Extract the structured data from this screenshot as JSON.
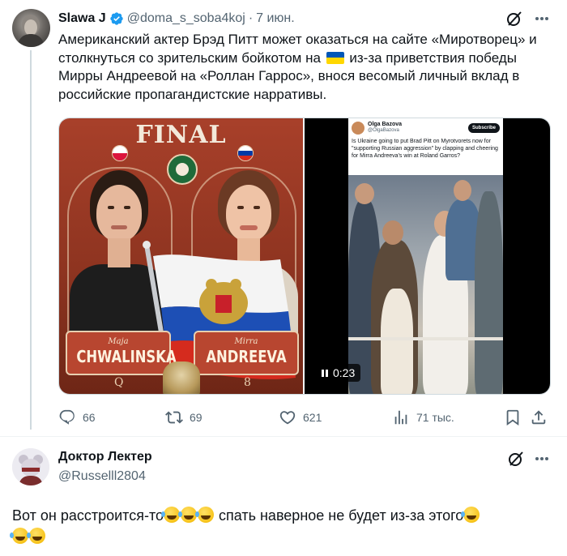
{
  "tweet": {
    "author_name": "Slawa J",
    "author_handle": "@doma_s_soba4koj",
    "separator": "·",
    "date": "7 июн.",
    "text_before_flag": "Американский актер Брэд Питт может оказаться на сайте «Миротворец» и столкнуться со зрительским бойкотом на ",
    "text_after_flag": " из-за приветствия победы Мирры Андреевой на «Роллан Гаррос», внося весомый личный вклад в российские пропагандистские нарративы.",
    "photo": {
      "title": "FINAL",
      "left_player_first": "Maja",
      "left_player_last": "CHWALINSKA",
      "left_seed": "Q",
      "right_player_first": "Mirra",
      "right_player_last": "ANDREEVA",
      "right_seed": "8"
    },
    "video": {
      "embedded_name": "Olga Bazova",
      "embedded_handle": "@OlgaBazova",
      "embedded_subscribe": "Subscribe",
      "embedded_text": "Is Ukraine going to put Brad Pitt on Myrotvorets now for \"supporting Russian aggression\" by clapping and cheering for Mirra Andreeva's win at Roland Garros?",
      "duration": "0:23"
    },
    "stats": {
      "replies": "66",
      "retweets": "69",
      "likes": "621",
      "views": "71 тыс."
    }
  },
  "reply": {
    "author_name": "Доктор Лектер",
    "author_handle": "@Russelll2804",
    "text_part1": "Вот он расстроится-то",
    "text_part2": " спать наверное не будет из-за этого"
  },
  "colors": {
    "text_primary": "#0f1419",
    "text_secondary": "#536471",
    "verified_blue": "#1d9bf0",
    "ukraine_blue": "#0057b7",
    "ukraine_yellow": "#ffd700"
  },
  "icons": {
    "verified": "verified-badge-icon",
    "grok": "grok-icon",
    "more": "more-icon",
    "reply": "reply-icon",
    "retweet": "retweet-icon",
    "like": "heart-icon",
    "views": "views-icon",
    "bookmark": "bookmark-icon",
    "share": "share-icon",
    "emoji": "rolling-on-floor-laughing-emoji"
  }
}
